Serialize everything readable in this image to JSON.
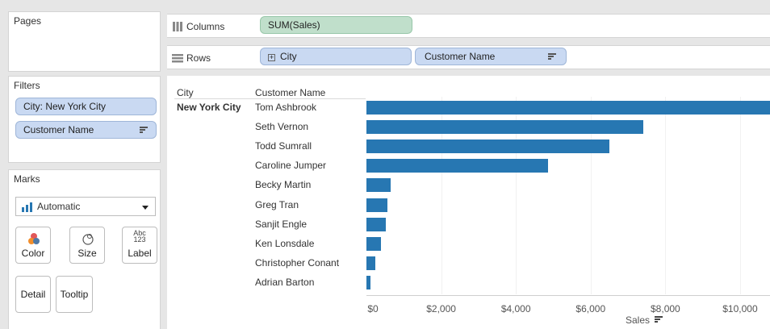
{
  "pages": {
    "title": "Pages"
  },
  "filters": {
    "title": "Filters",
    "items": [
      {
        "label": "City: New York City"
      },
      {
        "label": "Customer Name"
      }
    ]
  },
  "marks": {
    "title": "Marks",
    "type": "Automatic",
    "buttons": [
      {
        "label": "Color",
        "icon": "color-icon"
      },
      {
        "label": "Size",
        "icon": "size-icon"
      },
      {
        "label": "Label",
        "icon": "label-icon",
        "icon_text_1": "Abc",
        "icon_text_2": "123"
      },
      {
        "label": "Detail"
      },
      {
        "label": "Tooltip"
      }
    ]
  },
  "shelves": {
    "columns": {
      "label": "Columns",
      "pill": "SUM(Sales)"
    },
    "rows": {
      "label": "Rows",
      "pills": [
        "City",
        "Customer Name"
      ]
    }
  },
  "view": {
    "headers": {
      "city": "City",
      "customer": "Customer Name"
    },
    "city_value": "New York City",
    "axis_title": "Sales"
  },
  "colors": {
    "bar": "#2777b2",
    "pill_blue": "#c9d9f2",
    "pill_green": "#c0dfcb"
  },
  "chart_data": {
    "type": "bar",
    "orientation": "horizontal",
    "categories": [
      "Tom Ashbrook",
      "Seth Vernon",
      "Todd Sumrall",
      "Caroline Jumper",
      "Becky Martin",
      "Greg Tran",
      "Sanjit Engle",
      "Ken Lonsdale",
      "Christopher Conant",
      "Adrian Barton"
    ],
    "values": [
      11000,
      7400,
      6500,
      4850,
      650,
      570,
      520,
      390,
      240,
      110
    ],
    "xlabel": "Sales",
    "xlim": [
      0,
      10800
    ],
    "ticks": [
      "$0",
      "$2,000",
      "$4,000",
      "$6,000",
      "$8,000",
      "$10,000"
    ],
    "tick_values": [
      0,
      2000,
      4000,
      6000,
      8000,
      10000
    ]
  }
}
